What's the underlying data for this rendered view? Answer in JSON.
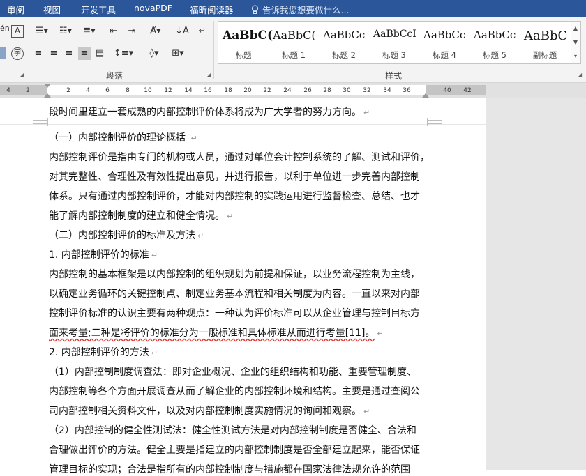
{
  "menu": {
    "tabs": [
      "审阅",
      "视图",
      "开发工具",
      "novaPDF",
      "福昕阅读器"
    ],
    "tell_me": "告诉我您想要做什么..."
  },
  "ribbon": {
    "paragraph_group_label": "段落",
    "styles_group_label": "样式",
    "font_partial": "én",
    "styles": [
      {
        "preview": "AaBbC(",
        "name": "标题"
      },
      {
        "preview": "AaBbC(",
        "name": "标题 1"
      },
      {
        "preview": "AaBbCc",
        "name": "标题 2"
      },
      {
        "preview": "AaBbCcI",
        "name": "标题 3"
      },
      {
        "preview": "AaBbCc",
        "name": "标题 4"
      },
      {
        "preview": "AaBbCc",
        "name": "标题 5"
      },
      {
        "preview": "AaBbC",
        "name": "副标题"
      }
    ]
  },
  "ruler": {
    "left_numbers": [
      "4",
      "2"
    ],
    "numbers": [
      "2",
      "4",
      "6",
      "8",
      "10",
      "12",
      "14",
      "16",
      "18",
      "20",
      "22",
      "24",
      "26",
      "28",
      "30",
      "32",
      "34",
      "36"
    ],
    "right_numbers": [
      "40",
      "42"
    ]
  },
  "document": {
    "lines": [
      {
        "text": "段时间里建立一套成熟的内部控制评价体系将成为广大学者的努力方向。",
        "mark": "↵"
      },
      {
        "text": "（一）内部控制评价的理论概括 ",
        "mark": "↵"
      },
      {
        "text": "内部控制评价是指由专门的机构或人员，通过对单位会计控制系统的了解、测试和评价，",
        "mark": ""
      },
      {
        "text": "对其完整性、合理性及有效性提出意见，并进行报告，以利于单位进一步完善内部控制",
        "mark": ""
      },
      {
        "text": "体系。只有通过内部控制评价，才能对内部控制的实践运用进行监督检查、总结、也才",
        "mark": ""
      },
      {
        "text": "能了解内部控制制度的建立和健全情况。",
        "mark": "↵"
      },
      {
        "text": "（二）内部控制评价的标准及方法",
        "mark": "↵"
      },
      {
        "text": "1. 内部控制评价的标准",
        "mark": "↵"
      },
      {
        "text": "内部控制的基本框架是以内部控制的组织规划为前提和保证，以业务流程控制为主线，",
        "mark": ""
      },
      {
        "text": "以确定业务循环的关键控制点、制定业务基本流程和相关制度为内容。一直以来对内部",
        "mark": ""
      },
      {
        "text": "控制评价标准的认识主要有两种观点：一种认为评价标准可以从企业管理与控制目标方",
        "mark": ""
      },
      {
        "text": "面来考量;二种是将评价的标准分为一般标准和具体标准从而进行考量[11]。",
        "mark": "↵"
      },
      {
        "text": "2. 内部控制评价的方法",
        "mark": "↵"
      },
      {
        "text": "（1）内部控制制度调查法：即对企业概况、企业的组织结构和功能、重要管理制度、",
        "mark": ""
      },
      {
        "text": "内部控制等各个方面开展调查从而了解企业的内部控制环境和结构。主要是通过查阅公",
        "mark": ""
      },
      {
        "text": "司内部控制相关资料文件，以及对内部控制制度实施情况的询问和观察。",
        "mark": "↵"
      },
      {
        "text": "（2）内部控制的健全性测试法：健全性测试方法是对内部控制制度是否健全、合法和",
        "mark": ""
      },
      {
        "text": "合理做出评价的方法。健全主要是指建立的内部控制制度是否全部建立起来，能否保证",
        "mark": ""
      },
      {
        "text": "管理目标的实现；合法是指所有的内部控制制度与措施都在国家法律法规允许的范围",
        "mark": ""
      }
    ]
  }
}
